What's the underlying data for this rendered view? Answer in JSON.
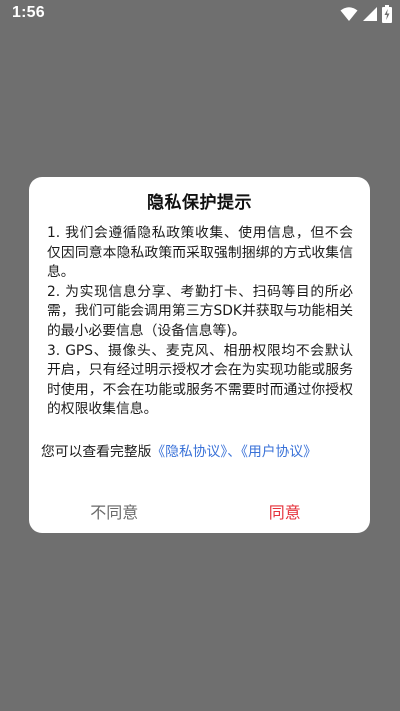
{
  "status_bar": {
    "time": "1:56",
    "icons": [
      "wifi-icon",
      "signal-icon",
      "battery-charging-icon"
    ]
  },
  "dialog": {
    "title": "隐私保护提示",
    "paragraphs": [
      "1. 我们会遵循隐私政策收集、使用信息，但不会仅因同意本隐私政策而采取强制捆绑的方式收集信息。",
      "2. 为实现信息分享、考勤打卡、扫码等目的所必需，我们可能会调用第三方SDK并获取与功能相关的最小必要信息（设备信息等)。",
      "3. GPS、摄像头、麦克风、相册权限均不会默认开启，只有经过明示授权才会在为实现功能或服务时使用，不会在功能或服务不需要时而通过你授权的权限收集信息。"
    ],
    "agreement_prefix": "您可以查看完整版",
    "privacy_link": "《隐私协议》",
    "separator": "、",
    "user_link": "《用户协议》",
    "disagree_label": "不同意",
    "agree_label": "同意"
  },
  "colors": {
    "overlay": "#6f6f6f",
    "link": "#3a72d8",
    "agree": "#e5313a",
    "disagree": "#6a6a6a"
  }
}
